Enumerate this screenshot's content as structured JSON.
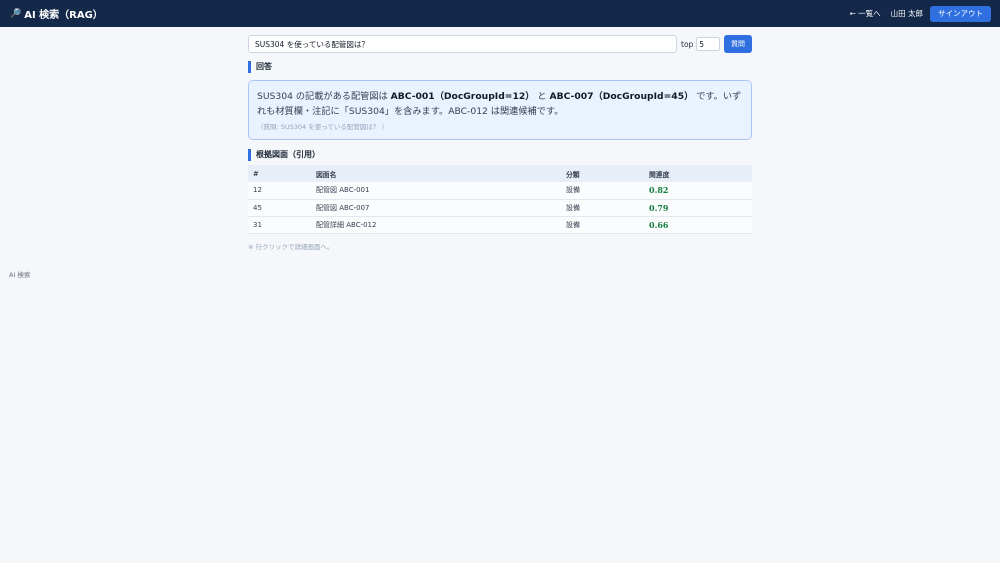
{
  "header": {
    "icon": "search-icon",
    "title": "AI 検索（RAG）",
    "back_label": "← 一覧へ",
    "user_name": "山田 太郎",
    "signout_label": "サインアウト"
  },
  "search": {
    "query_value": "SUS304 を使っている配管図は？",
    "topk_label": "top",
    "topk_value": "5",
    "ask_label": "質問"
  },
  "answer": {
    "heading": "回答",
    "text_before": "SUS304 の記載がある配管図は ",
    "bold_1": "ABC-001（DocGroupId=12）",
    "text_mid": " と ",
    "bold_2": "ABC-007（DocGroupId=45）",
    "text_after": " です。いずれも材質欄・注記に「SUS304」を含みます。ABC-012 は関連候補です。",
    "question_echo": "（質問: SUS304 を使っている配管図は？ ）"
  },
  "citations": {
    "heading": "根拠図面（引用）",
    "columns": [
      "#",
      "図面名",
      "分類",
      "関連度"
    ],
    "rows": [
      {
        "id": "12",
        "name": "配管図 ABC-001",
        "category": "設備",
        "score": "0.82"
      },
      {
        "id": "45",
        "name": "配管図 ABC-007",
        "category": "設備",
        "score": "0.79"
      },
      {
        "id": "31",
        "name": "配管詳細 ABC-012",
        "category": "設備",
        "score": "0.66"
      }
    ],
    "note": "※ 行クリックで詳細画面へ。"
  },
  "footer": {
    "label": "AI 検索"
  },
  "colors": {
    "header_bg": "#14294a",
    "accent": "#2f6fe0",
    "score": "#15803d"
  }
}
